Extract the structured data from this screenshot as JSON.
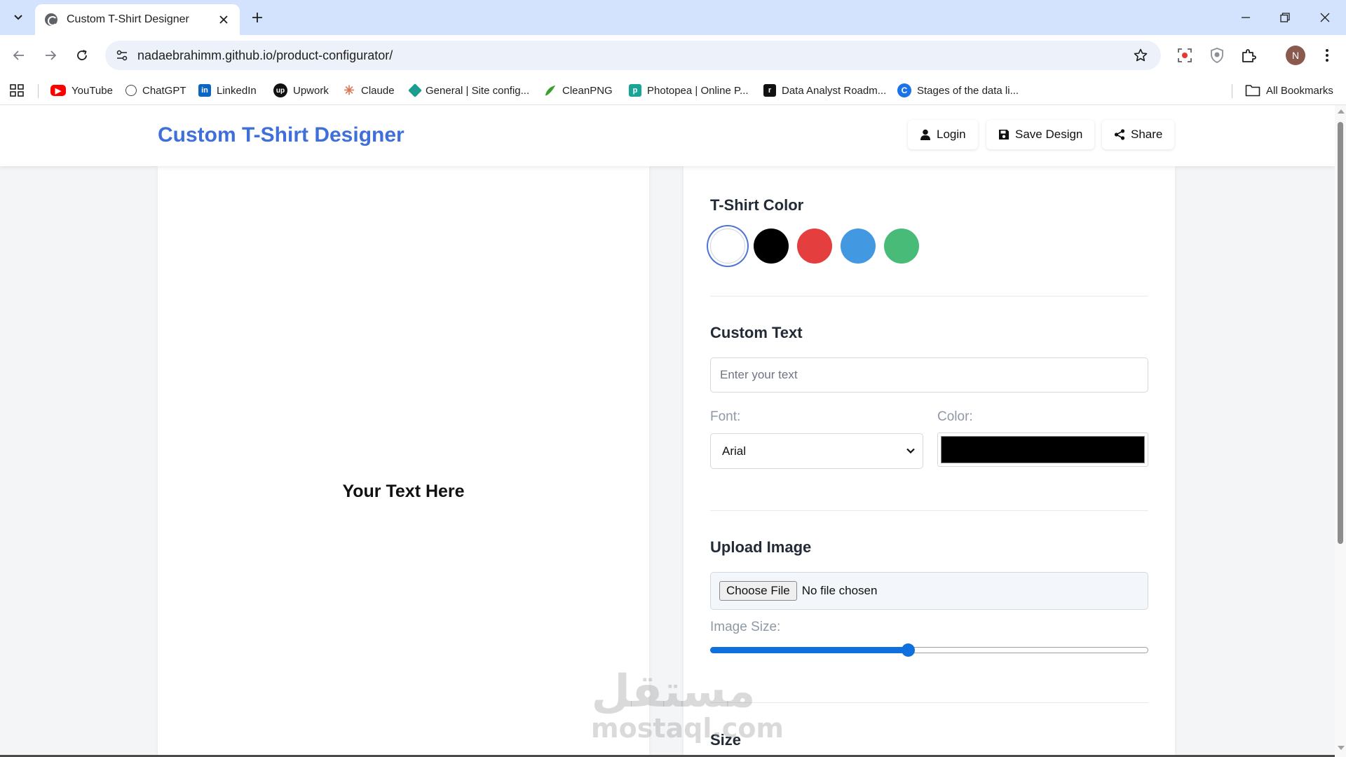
{
  "browser": {
    "tab_title": "Custom T-Shirt Designer",
    "url": "nadaebrahimm.github.io/product-configurator/",
    "avatar_initial": "N",
    "bookmarks": [
      {
        "label": "YouTube",
        "icon": "youtube-icon",
        "color": "#ff0000"
      },
      {
        "label": "ChatGPT",
        "icon": "chatgpt-icon",
        "color": "#444444"
      },
      {
        "label": "LinkedIn",
        "icon": "linkedin-icon",
        "color": "#0a66c2"
      },
      {
        "label": "Upwork",
        "icon": "upwork-icon",
        "color": "#111111"
      },
      {
        "label": "Claude",
        "icon": "claude-icon",
        "color": "#d97757"
      },
      {
        "label": "General | Site config...",
        "icon": "site-config-icon",
        "color": "#1a9c8e"
      },
      {
        "label": "CleanPNG",
        "icon": "cleanpng-icon",
        "color": "#3aa02e"
      },
      {
        "label": "Photopea | Online P...",
        "icon": "photopea-icon",
        "color": "#18a497"
      },
      {
        "label": "Data Analyst Roadm...",
        "icon": "roadmap-icon",
        "color": "#111111"
      },
      {
        "label": "Stages of the data li...",
        "icon": "stages-icon",
        "color": "#1a73e8"
      }
    ],
    "all_bookmarks_label": "All Bookmarks"
  },
  "header": {
    "logo": "Custom T-Shirt Designer",
    "login_label": "Login",
    "save_label": "Save Design",
    "share_label": "Share"
  },
  "preview": {
    "text": "Your Text Here"
  },
  "panel": {
    "color_section": {
      "title": "T-Shirt Color",
      "swatches": [
        "#ffffff",
        "#000000",
        "#e53e3e",
        "#4299e1",
        "#48bb78"
      ],
      "selected_index": 0
    },
    "text_section": {
      "title": "Custom Text",
      "placeholder": "Enter your text",
      "font_label": "Font:",
      "font_value": "Arial",
      "color_label": "Color:",
      "text_color": "#000000"
    },
    "image_section": {
      "title": "Upload Image",
      "choose_file_label": "Choose File",
      "file_status": "No file chosen",
      "size_label": "Image Size:",
      "size_fraction": 0.45
    },
    "size_section": {
      "title": "Size"
    }
  },
  "watermark": {
    "arabic": "مستقل",
    "latin": "mostaql.com"
  }
}
